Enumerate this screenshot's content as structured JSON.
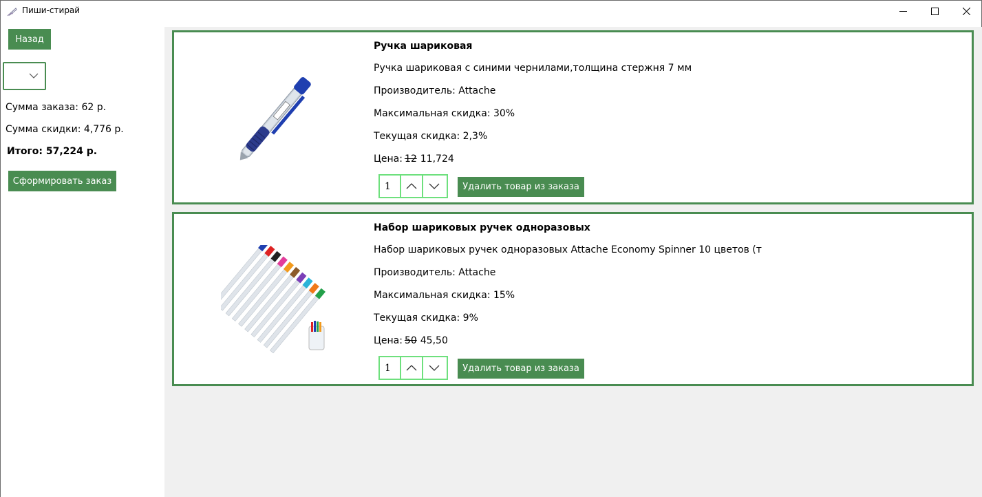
{
  "window": {
    "title": "Пиши-стирай"
  },
  "left_panel": {
    "back_label": "Назад",
    "combo_value": "",
    "order_sum": "Сумма заказа: 62 р.",
    "discount_sum": "Сумма скидки: 4,776 р.",
    "total": "Итого: 57,224 р.",
    "form_order_label": "Сформировать заказ"
  },
  "products": [
    {
      "name": "Ручка шариковая",
      "description": "Ручка шариковая с синими чернилами,толщина стержня 7 мм",
      "manufacturer": "Производитель: Attache",
      "max_discount": "Максимальная скидка: 30%",
      "current_discount": "Текущая скидка: 2,3%",
      "price_label": "Цена:",
      "old_price": "12",
      "new_price": "11,724",
      "quantity": "1",
      "remove_label": "Удалить товар из заказа",
      "image_icon": "ballpoint-pen-image"
    },
    {
      "name": "Набор шариковых ручек одноразовых",
      "description": "Набор шариковых ручек одноразовых Attache Economy Spinner 10 цветов (т",
      "manufacturer": "Производитель: Attache",
      "max_discount": "Максимальная скидка: 15%",
      "current_discount": "Текущая скидка: 9%",
      "price_label": "Цена:",
      "old_price": "50",
      "new_price": "45,50",
      "quantity": "1",
      "remove_label": "Удалить товар из заказа",
      "image_icon": "pen-set-image"
    }
  ],
  "colors": {
    "accent": "#498c51",
    "stepper_border": "#6ee07d",
    "list_bg": "#f0f0f0"
  }
}
